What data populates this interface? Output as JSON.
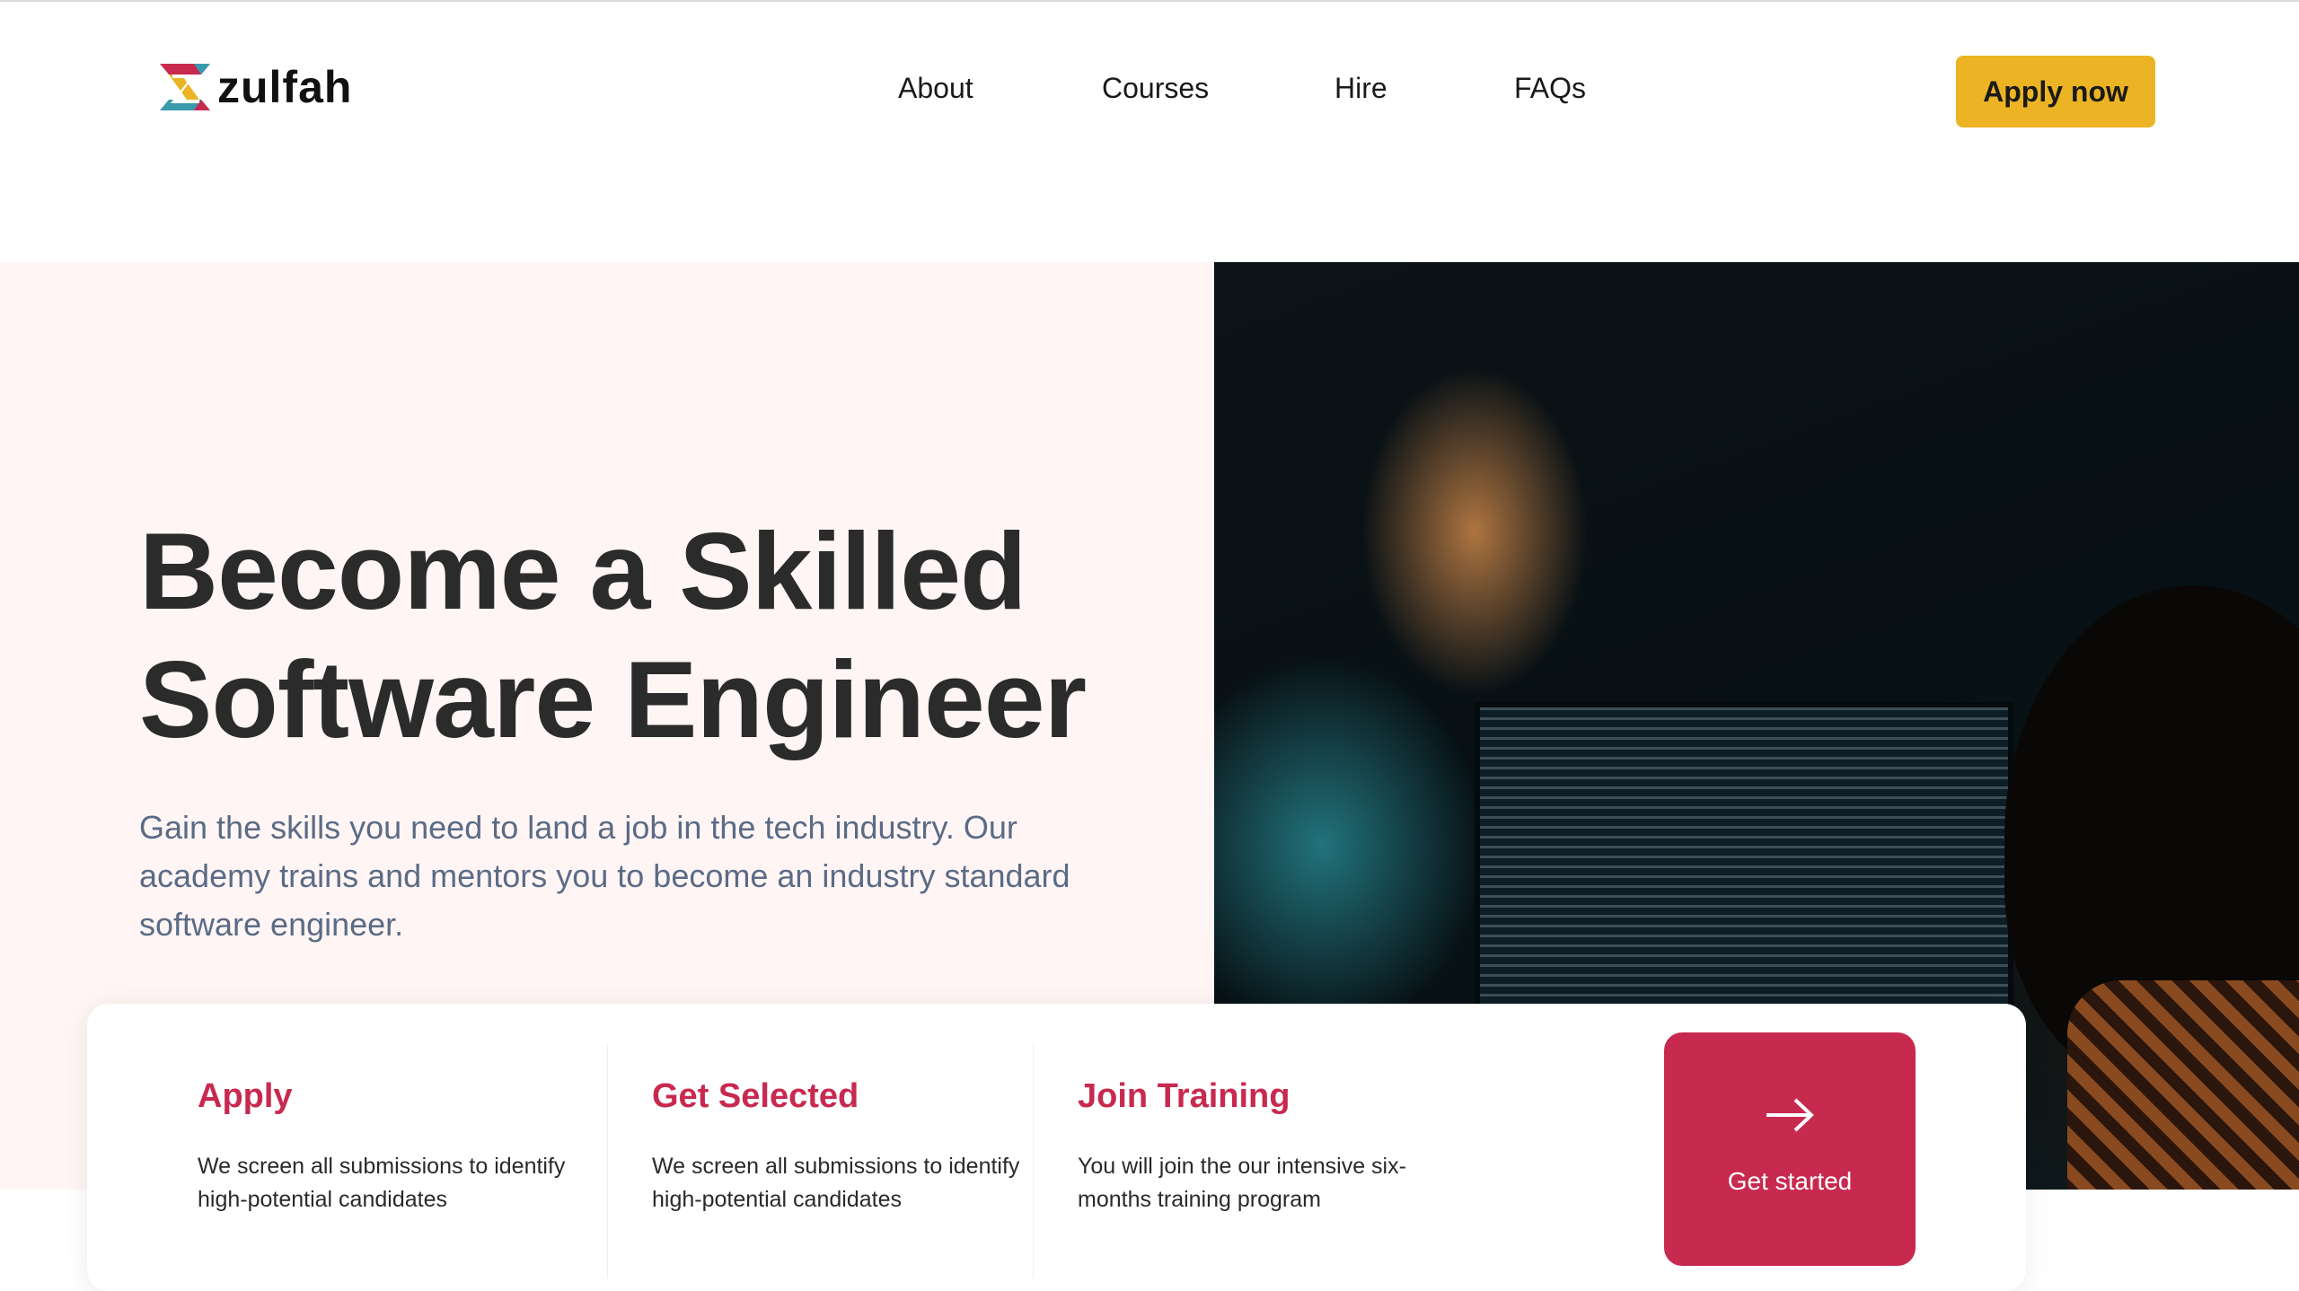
{
  "brand": {
    "name": "zulfah",
    "logo_colors": [
      "#c8294f",
      "#ecb424",
      "#3a9aad"
    ]
  },
  "nav": {
    "items": [
      "About",
      "Courses",
      "Hire",
      "FAQs"
    ],
    "cta": "Apply now"
  },
  "hero": {
    "title_line1": "Become a Skilled",
    "title_line2": "Software Engineer",
    "lead": "Gain the skills you need to land a job in the tech industry. Our academy trains and mentors you to become an industry standard software engineer."
  },
  "steps": [
    {
      "title": "Apply",
      "text": "We screen all submissions to identify high-potential candidates"
    },
    {
      "title": "Get Selected",
      "text": "We screen all submissions to identify high-potential candidates"
    },
    {
      "title": "Join Training",
      "text": "You will join the our intensive six-months training program"
    }
  ],
  "cta": {
    "label": "Get started",
    "icon": "arrow-right-icon"
  },
  "colors": {
    "accent": "#c8294f",
    "button": "#ecb424",
    "hero_bg": "#fff5f5"
  }
}
